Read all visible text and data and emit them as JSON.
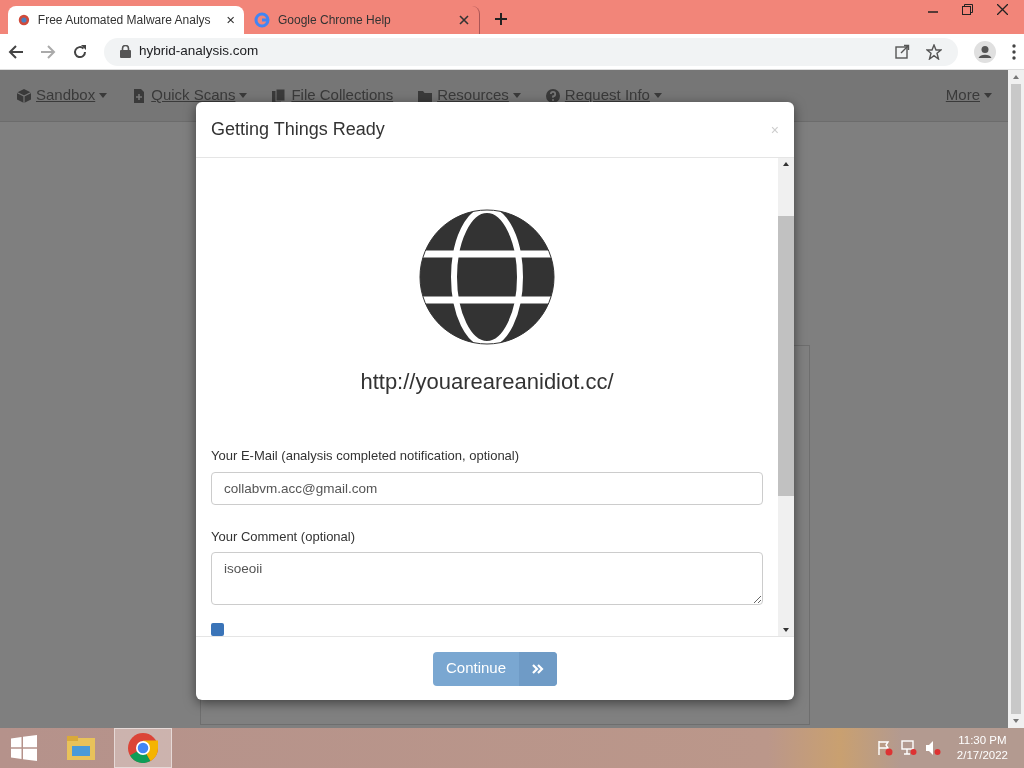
{
  "browser": {
    "tabs": [
      {
        "title": "Free Automated Malware Analys",
        "selected": true
      },
      {
        "title": "Google Chrome Help",
        "selected": false
      }
    ],
    "address": "hybrid-analysis.com"
  },
  "nav": {
    "items": [
      {
        "label": "Sandbox",
        "dropdown": true
      },
      {
        "label": "Quick Scans",
        "dropdown": true
      },
      {
        "label": "File Collections",
        "dropdown": false
      },
      {
        "label": "Resources",
        "dropdown": true
      },
      {
        "label": "Request Info",
        "dropdown": true
      }
    ],
    "more": "More"
  },
  "modal": {
    "title": "Getting Things Ready",
    "close": "×",
    "url": "http://youareareanidiot.cc/",
    "email": {
      "label": "Your E-Mail (analysis completed notification, optional)",
      "value": "collabvm.acc@gmail.com"
    },
    "comment": {
      "label": "Your Comment (optional)",
      "value": "isoeoii"
    },
    "consent": {
      "checked": true
    },
    "button": "Continue"
  },
  "taskbar": {
    "time": "11:30 PM",
    "date": "2/17/2022"
  }
}
